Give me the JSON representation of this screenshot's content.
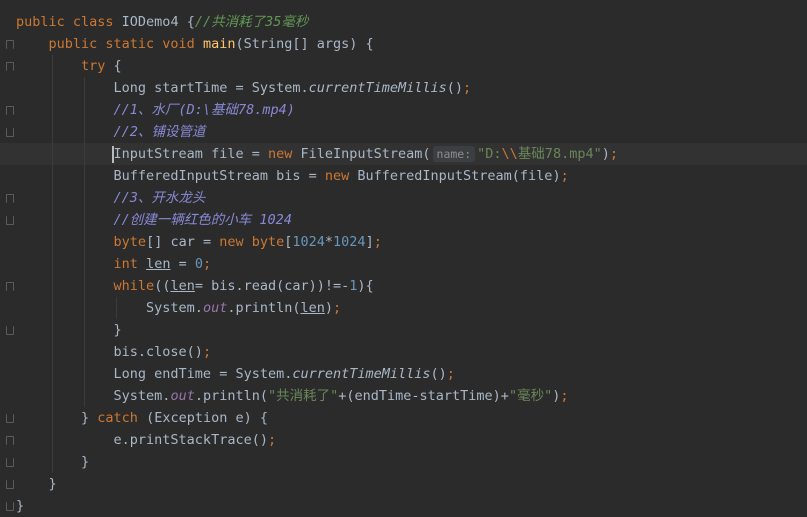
{
  "editor": {
    "lines": [
      "public class IODemo4 {//共消耗了35毫秒",
      "    public static void main(String[] args) {",
      "        try {",
      "            Long startTime = System.currentTimeMillis();",
      "            //1、水厂(D:\\基础78.mp4)",
      "            //2、铺设管道",
      "            InputStream file = new FileInputStream( name: \"D:\\\\基础78.mp4\");",
      "            BufferedInputStream bis = new BufferedInputStream(file);",
      "            //3、开水龙头",
      "            //创建一辆红色的小车 1024",
      "            byte[] car = new byte[1024*1024];",
      "            int len = 0;",
      "            while((len= bis.read(car))!=-1){",
      "                System.out.println(len);",
      "            }",
      "            bis.close();",
      "            Long endTime = System.currentTimeMillis();",
      "            System.out.println(\"共消耗了\"+(endTime-startTime)+\"毫秒\");",
      "        } catch (Exception e) {",
      "            e.printStackTrace();",
      "        }",
      "    }",
      "}"
    ],
    "param_hint": "name:",
    "theme_colors": {
      "background": "#2b2b2b",
      "keyword": "#cc7832",
      "number": "#6897bb",
      "string": "#6a8759",
      "comment": "#629755",
      "method": "#ffc66d",
      "field": "#9876aa",
      "text": "#a9b7c6"
    }
  }
}
